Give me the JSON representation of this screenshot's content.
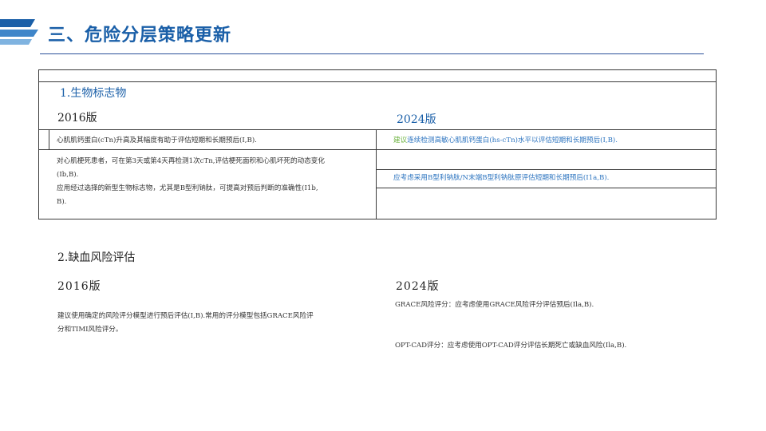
{
  "header": {
    "title": "三、危险分层策略更新",
    "logo_icon": "blue-stripes-logo-icon"
  },
  "section1": {
    "title": "1.生物标志物",
    "label_2016": "2016版",
    "label_2024": "2024版",
    "row1_left": "心肌肌钙蛋白(cTn)升高及其幅度有助于评估短期和长期预后(I,B).",
    "row1_right_prefix": "建议",
    "row1_right_text": "连续检测高敏心肌肌钙蛋白(hs-cTn)水平以评估短期和长期预后(I,B).",
    "row2_left_lines": [
      "对心肌梗死患者，可在第3天或第4天再检测1次cTn,评估梗死面积和心肌坏死的动态变化",
      "(Ib,B).",
      "应用经过选择的新型生物标志物，尤其是B型利钠肽，可提高对预后判断的准确性(I1b,",
      "B)."
    ],
    "row2_right": "应考虑采用B型利钠肽/N末端B型利钠肽原评估短期和长期预后(I1a,B)."
  },
  "section2": {
    "title": "2.缺血风险评估",
    "label_2016": "2016版",
    "label_2024": "2024版",
    "left_lines": [
      "建议使用确定的风险评分模型进行预后评估(I,B).常用的评分模型包括GRACE风险评",
      "分和TIMI风险评分。"
    ],
    "right_item1": "GRACE风险评分：应考虑使用GRACE风险评分评估预后(Ila,B).",
    "right_item2": "OPT-CAD评分：应考虑使用OPT-CAD评分评估长期死亡或缺血风险(Ila,B)."
  },
  "colors": {
    "title_blue": "#1a5fa8",
    "text_blue": "#2e75c0",
    "accent_green": "#6cb33f",
    "rule_blue": "#2a4f9a"
  }
}
